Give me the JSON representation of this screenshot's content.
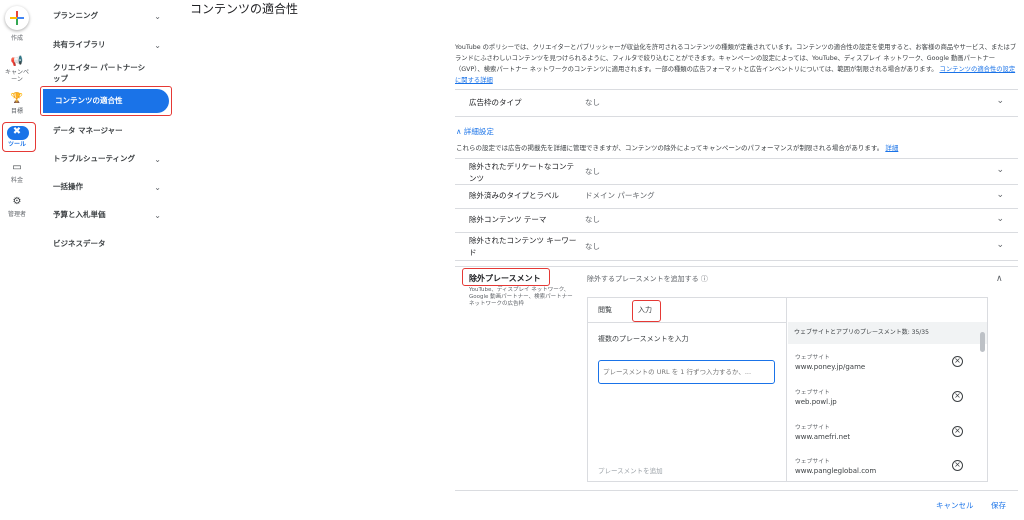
{
  "rail": {
    "items": [
      {
        "label": "作成",
        "icon": "plus-icon"
      },
      {
        "label": "キャンペーン",
        "icon": "megaphone-icon"
      },
      {
        "label": "目標",
        "icon": "trophy-icon"
      },
      {
        "label": "ツール",
        "icon": "tools-icon"
      },
      {
        "label": "料金",
        "icon": "billing-icon"
      },
      {
        "label": "管理者",
        "icon": "gear-icon"
      }
    ]
  },
  "nav": {
    "items": [
      {
        "label": "プランニング"
      },
      {
        "label": "共有ライブラリ"
      },
      {
        "label": "クリエイター パートナーシップ"
      },
      {
        "label": "コンテンツの適合性"
      },
      {
        "label": "データ マネージャー"
      },
      {
        "label": "トラブルシューティング"
      },
      {
        "label": "一括操作"
      },
      {
        "label": "予算と入札単価"
      },
      {
        "label": "ビジネスデータ"
      }
    ]
  },
  "page": {
    "title": "コンテンツの適合性"
  },
  "policy": {
    "text": "YouTube のポリシーでは、クリエイターとパブリッシャーが収益化を許可されるコンテンツの種類が定義されています。コンテンツの適合性の設定を使用すると、お客様の商品やサービス、またはブランドにふさわしいコンテンツを見つけられるように、フィルタで絞り込むことができます。キャンペーンの設定によっては、YouTube、ディスプレイ ネットワーク、Google 動画パートナー（GVP）、検索パートナー ネットワークのコンテンツに適用されます。一部の種類の広告フォーマットと広告インベントリについては、範囲が制限される場合があります。",
    "link": "コンテンツの適合性の設定に関する詳細"
  },
  "inventory": {
    "label": "広告枠のタイプ",
    "value": "なし"
  },
  "advanced": {
    "toggle": "詳細設定",
    "desc": "これらの設定では広告の掲載先を詳細に管理できますが、コンテンツの除外によってキャンペーンのパフォーマンスが制限される場合があります。",
    "desc_link": "詳細",
    "rows": [
      {
        "label": "除外されたデリケートなコンテンツ",
        "value": "なし"
      },
      {
        "label": "除外済みのタイプとラベル",
        "value": "ドメイン パーキング"
      },
      {
        "label": "除外コンテンツ テーマ",
        "value": "なし"
      },
      {
        "label": "除外されたコンテンツ キーワード",
        "value": "なし"
      }
    ]
  },
  "excluded": {
    "title": "除外プレースメント",
    "subtitle": "YouTube、ディスプレイ ネットワーク、Google 動画パートナー、検索パートナー ネットワークの広告枠",
    "header": "除外するプレースメントを追加する",
    "tabs": [
      "閲覧",
      "入力"
    ],
    "multi_label": "複数のプレースメントを入力",
    "input_placeholder": "プレースメントの URL を 1 行ずつ入力するか、...",
    "add_link": "プレースメントを追加",
    "list_header": "ウェブサイトとアプリのプレースメント数: 35/35",
    "items": [
      {
        "type": "ウェブサイト",
        "url": "www.poney.jp/game"
      },
      {
        "type": "ウェブサイト",
        "url": "web.powl.jp"
      },
      {
        "type": "ウェブサイト",
        "url": "www.amefri.net"
      },
      {
        "type": "ウェブサイト",
        "url": "www.pangleglobal.com"
      }
    ]
  },
  "footer": {
    "cancel": "キャンセル",
    "save": "保存"
  },
  "colors": {
    "accent": "#1a73e8",
    "highlight": "#e53935"
  }
}
